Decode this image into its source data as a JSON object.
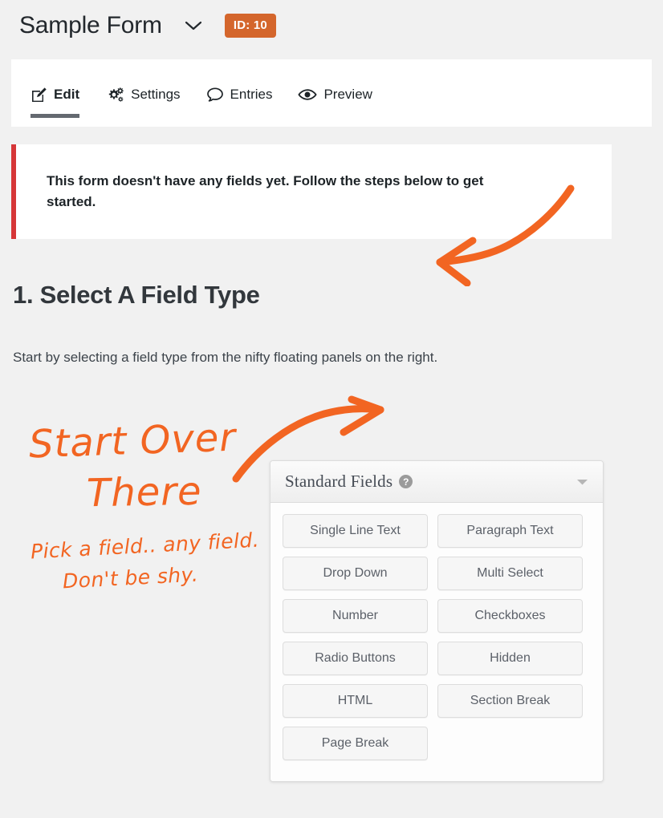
{
  "header": {
    "form_title": "Sample Form",
    "chevron_icon": "chevron-down-icon",
    "id_badge": "ID: 10",
    "badge_color": "#d4662c"
  },
  "tabs": [
    {
      "label": "Edit",
      "icon": "edit-pencil-icon",
      "active": true
    },
    {
      "label": "Settings",
      "icon": "gears-icon",
      "active": false
    },
    {
      "label": "Entries",
      "icon": "speech-bubble-icon",
      "active": false
    },
    {
      "label": "Preview",
      "icon": "eye-icon",
      "active": false
    }
  ],
  "notice": {
    "text": "This form doesn't have any fields yet. Follow the steps below to get started.",
    "accent_color": "#d63638"
  },
  "step": {
    "heading": "1. Select A Field Type",
    "description": "Start by selecting a field type from the nifty floating panels on the right."
  },
  "annotations": {
    "color": "#f26522",
    "line1": "Start Over",
    "line2": "There",
    "line3": "Pick a field.. any field.",
    "line4": "Don't be shy.",
    "arrow_top": "curved-arrow-pointing-left",
    "arrow_mid": "curved-arrow-pointing-right"
  },
  "field_panel": {
    "title": "Standard Fields",
    "help_icon": "question-mark-icon",
    "help_glyph": "?",
    "toggle_icon": "chevron-down-icon",
    "buttons": [
      "Single Line Text",
      "Paragraph Text",
      "Drop Down",
      "Multi Select",
      "Number",
      "Checkboxes",
      "Radio Buttons",
      "Hidden",
      "HTML",
      "Section Break",
      "Page Break"
    ]
  }
}
